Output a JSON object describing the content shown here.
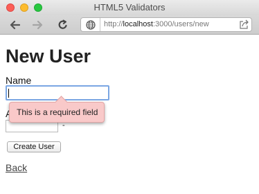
{
  "window": {
    "title": "HTML5 Validators"
  },
  "address_bar": {
    "url_prefix": "http://",
    "url_host": "localhost",
    "url_rest": ":3000/users/new"
  },
  "icons": {
    "back": "arrow-left-icon",
    "forward": "arrow-right-icon",
    "reload": "reload-icon",
    "site": "globe-icon",
    "share": "share-icon"
  },
  "form": {
    "heading": "New User",
    "name_label": "Name",
    "name_value": "",
    "age_label": "A",
    "age_value": "",
    "age_stepper_mark": "-",
    "submit_label": "Create User",
    "validation_message": "This is a required field"
  },
  "links": {
    "back": "Back"
  },
  "colors": {
    "tooltip_bg": "#f9c9c9",
    "focus_ring": "#7aa6e3",
    "close": "#fc5f57",
    "minimize": "#fdbc2e",
    "zoom": "#28c840"
  }
}
